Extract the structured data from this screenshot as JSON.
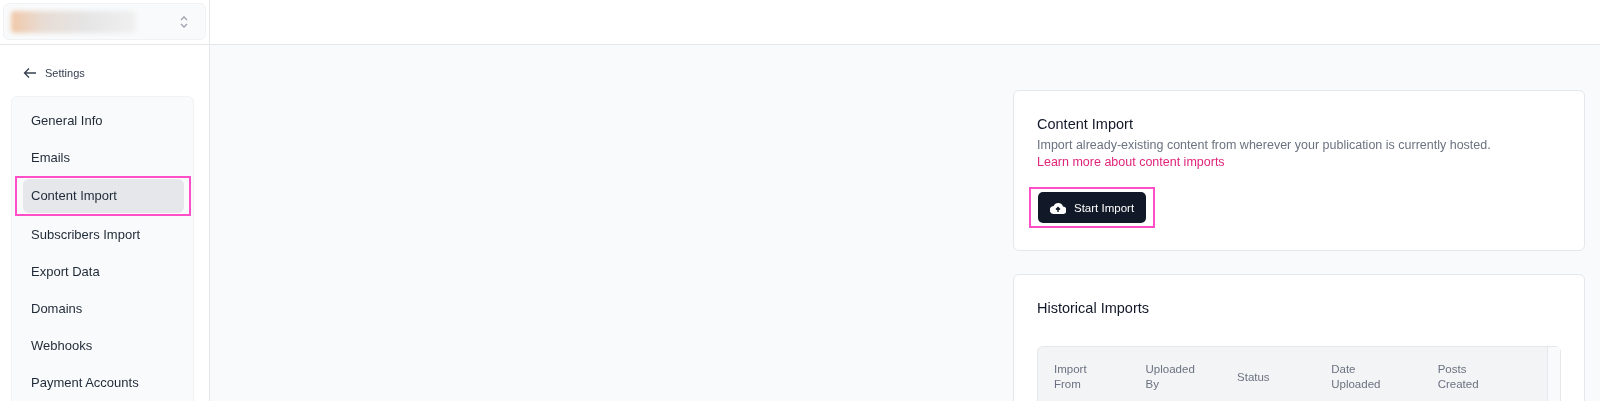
{
  "sidebar": {
    "back_link": "Settings",
    "items": [
      {
        "label": "General Info",
        "selected": false,
        "highlighted": false
      },
      {
        "label": "Emails",
        "selected": false,
        "highlighted": false
      },
      {
        "label": "Content Import",
        "selected": true,
        "highlighted": true
      },
      {
        "label": "Subscribers Import",
        "selected": false,
        "highlighted": false
      },
      {
        "label": "Export Data",
        "selected": false,
        "highlighted": false
      },
      {
        "label": "Domains",
        "selected": false,
        "highlighted": false
      },
      {
        "label": "Webhooks",
        "selected": false,
        "highlighted": false
      },
      {
        "label": "Payment Accounts",
        "selected": false,
        "highlighted": false
      }
    ]
  },
  "content_import": {
    "title": "Content Import",
    "description": "Import already-existing content from wherever your publication is currently hosted.",
    "link": "Learn more about content imports",
    "button": {
      "label": "Start Import",
      "highlighted": true
    }
  },
  "historical_imports": {
    "title": "Historical Imports",
    "table": {
      "columns": [
        "Import From",
        "Uploaded By",
        "Status",
        "Date Uploaded",
        "Posts Created"
      ]
    }
  }
}
